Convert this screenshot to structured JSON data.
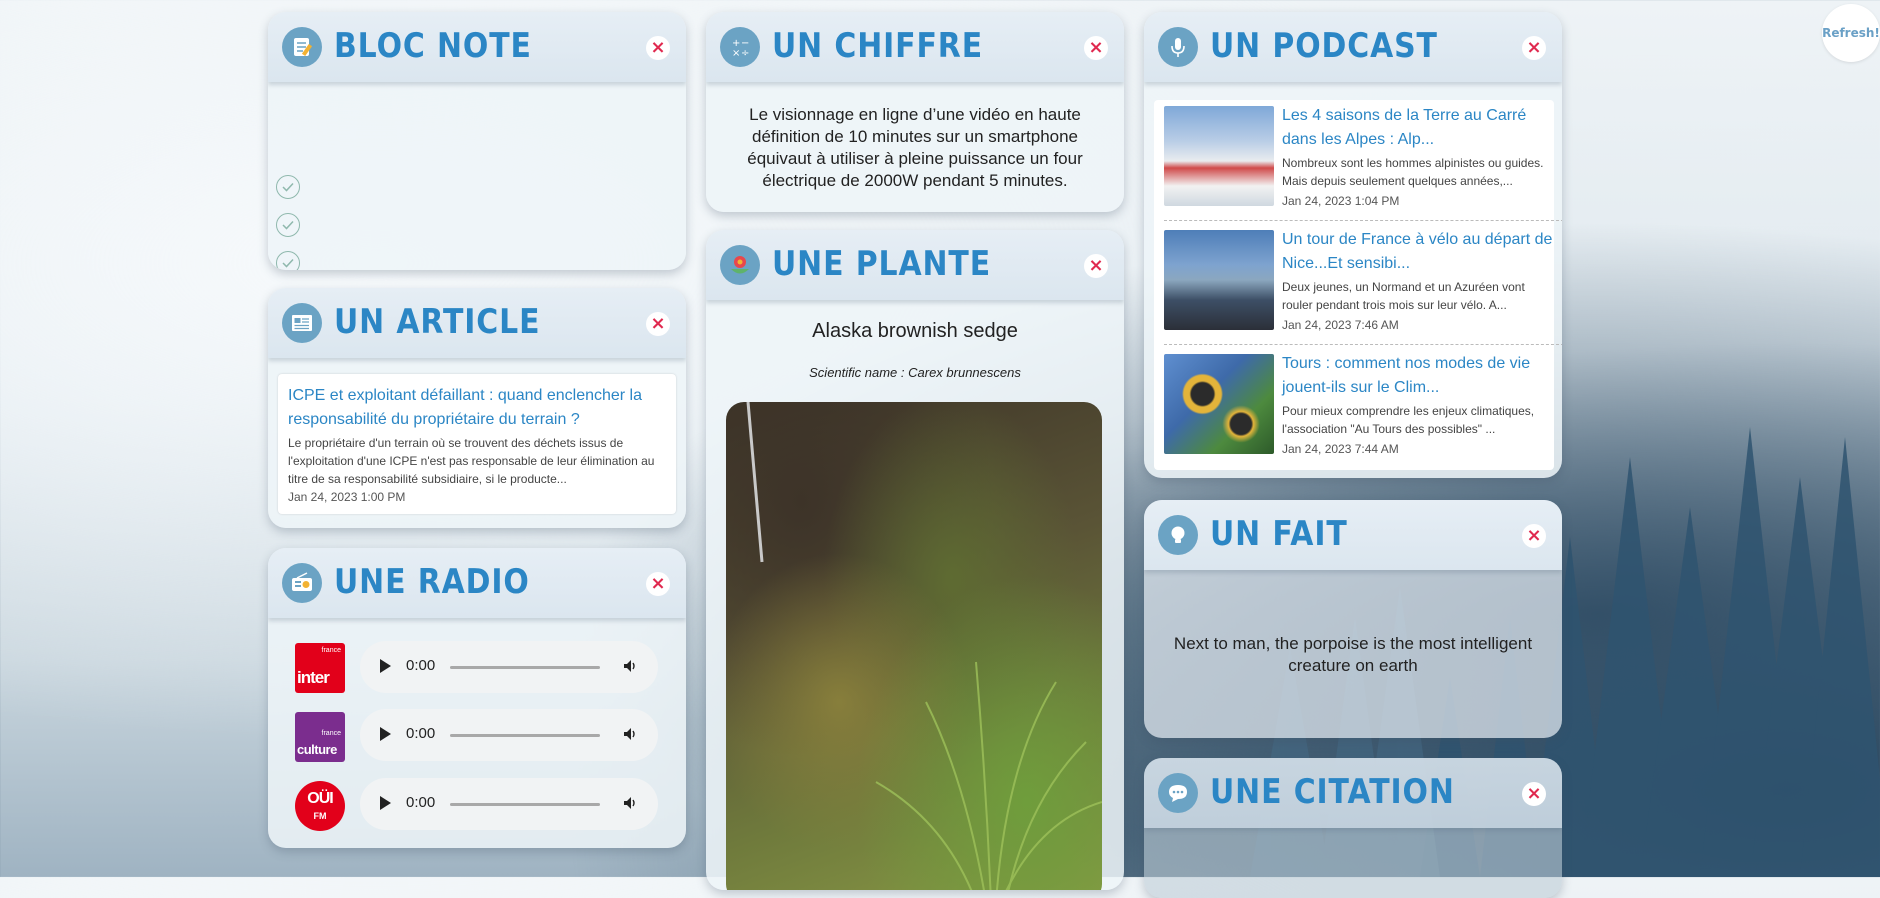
{
  "refresh_label": "Refresh!",
  "bloc_note": {
    "title": "BLOC NOTE",
    "close": "×",
    "items": [
      "",
      "",
      "",
      ""
    ]
  },
  "article": {
    "title": "UN ARTICLE",
    "close": "×",
    "headline": "ICPE et exploitant défaillant : quand enclencher la responsabilité du propriétaire du terrain ?",
    "summary": "Le propriétaire d'un terrain où se trouvent des déchets issus de l'exploitation d'une ICPE n'est pas responsable de leur élimination au titre de sa responsabilité subsidiaire, si le producte...",
    "date": "Jan 24, 2023 1:00 PM"
  },
  "radio": {
    "title": "UNE RADIO",
    "close": "×",
    "stations": [
      {
        "name": "France Inter",
        "logo_text": "inter",
        "small": "france",
        "color": "#e2001a",
        "time": "0:00"
      },
      {
        "name": "France Culture",
        "logo_text": "culture",
        "small": "france",
        "color": "#7b2d8e",
        "time": "0:00"
      },
      {
        "name": "Oüi FM",
        "logo_text": "OÜI",
        "small": "FM",
        "color": "#e2001a",
        "time": "0:00"
      }
    ]
  },
  "chiffre": {
    "title": "UN CHIFFRE",
    "close": "×",
    "text": "Le visionnage en ligne d’une vidéo en haute définition de 10 minutes sur un smartphone équivaut à utiliser à pleine puissance un four électrique de 2000W pendant 5 minutes."
  },
  "plante": {
    "title": "UNE PLANTE",
    "close": "×",
    "name": "Alaska brownish sedge",
    "scientific_label": "Scientific name : Carex brunnescens"
  },
  "podcast": {
    "title": "UN PODCAST",
    "close": "×",
    "items": [
      {
        "title": "Les 4 saisons de la Terre au Carré dans les Alpes : Alp...",
        "desc": "Nombreux sont les hommes alpinistes ou guides. Mais depuis seulement quelques années,...",
        "date": "Jan 24, 2023 1:04 PM"
      },
      {
        "title": "Un tour de France à vélo au départ de Nice...Et sensibi...",
        "desc": "Deux jeunes, un Normand et un Azuréen vont rouler pendant trois mois sur leur vélo. A...",
        "date": "Jan 24, 2023 7:46 AM"
      },
      {
        "title": "Tours : comment nos modes de vie jouent-ils sur le Clim...",
        "desc": "Pour mieux comprendre les enjeux climatiques, l'association \"Au Tours des possibles\" ...",
        "date": "Jan 24, 2023 7:44 AM"
      }
    ]
  },
  "fait": {
    "title": "UN FAIT",
    "close": "×",
    "text": "Next to man, the porpoise is the most intelligent creature on earth"
  },
  "citation": {
    "title": "UNE CITATION",
    "close": "×"
  },
  "colors": {
    "accent": "#2b86c5",
    "close": "#e0294f",
    "icon_bg": "#6ba3c4"
  }
}
